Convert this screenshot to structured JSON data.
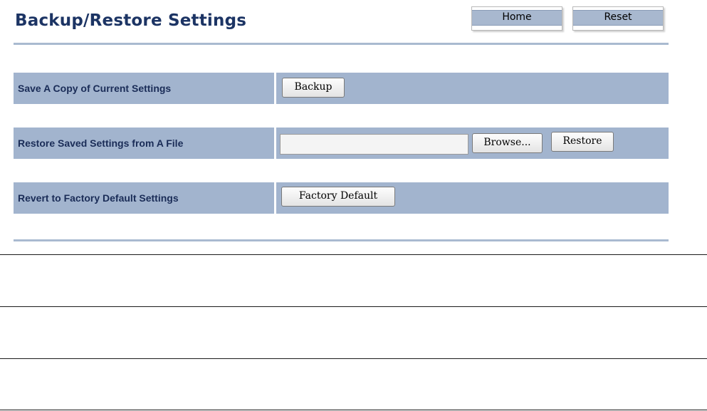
{
  "header": {
    "title": "Backup/Restore Settings",
    "home_label": "Home",
    "reset_label": "Reset"
  },
  "rows": {
    "backup": {
      "label": "Save A Copy of Current Settings",
      "button": "Backup"
    },
    "restore": {
      "label": "Restore Saved Settings from A File",
      "file_value": "",
      "browse_button": "Browse...",
      "button": "Restore"
    },
    "factory": {
      "label": "Revert to Factory Default Settings",
      "button": "Factory Default"
    }
  },
  "colors": {
    "title": "#1c3464",
    "row_band": "#a2b4ce",
    "rule": "#a9bad0"
  }
}
